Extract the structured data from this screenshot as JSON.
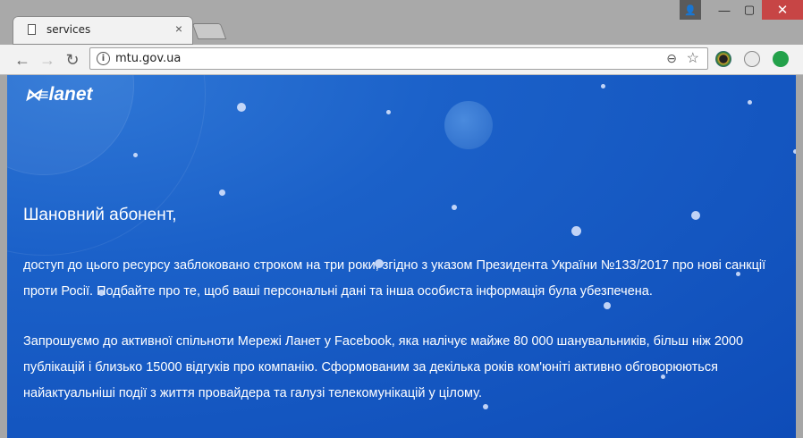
{
  "browser": {
    "tab_title": "services",
    "url": "mtu.gov.ua",
    "close_tab": "×",
    "window_controls": {
      "minimize": "—",
      "maximize": "▢",
      "close": "✕"
    }
  },
  "page": {
    "logo_text": "lanet",
    "greeting": "Шановний абонент,",
    "paragraph1_line1": "доступ до цього ресурсу заблоковано строком на три роки, згідно з указом Президента України №133/2017 про нові санкції",
    "paragraph1_line2": "проти Росії. Подбайте про те, щоб ваші персональні дані та інша особиста інформація була убезпечена.",
    "paragraph2_line1": "Запрошуємо до активної спільноти Мережі Ланет у Facebook, яка налічує майже 80 000 шанувальників, більш ніж 2000",
    "paragraph2_line2": "публікацій і близько 15000 відгуків про компанію. Сформованим за декілька років ком'юніті активно обговорюються",
    "paragraph2_line3": "найактуальніші події з життя провайдера та галузі телекомунікацій у цілому."
  },
  "colors": {
    "page_bg": "#1b61c9",
    "text": "#ffffff"
  },
  "icons": [
    "page-icon",
    "user-icon",
    "back-icon",
    "forward-icon",
    "reload-icon",
    "info-icon",
    "zoom-icon",
    "star-icon",
    "extension-icon",
    "update-icon"
  ]
}
